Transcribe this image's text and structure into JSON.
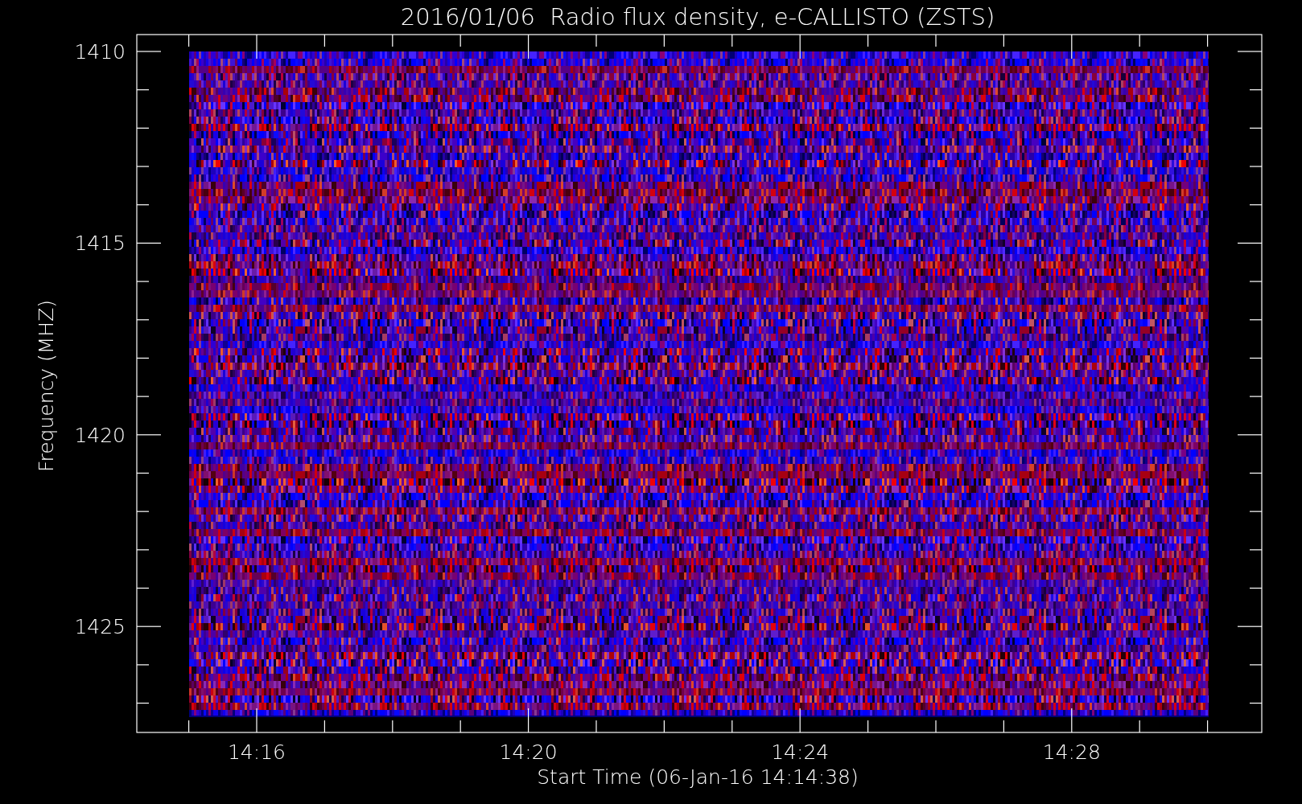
{
  "chart": {
    "title": "2016/01/06  Radio flux density, e-CALLISTO (ZSTS)",
    "ylabel": "Frequency (MHZ)",
    "xlabel": "Start Time (06-Jan-16 14:14:38)",
    "yticks": [
      "1410",
      "1415",
      "1420",
      "1425"
    ],
    "xticks": [
      "14:16",
      "14:20",
      "14:24",
      "14:28"
    ]
  }
}
